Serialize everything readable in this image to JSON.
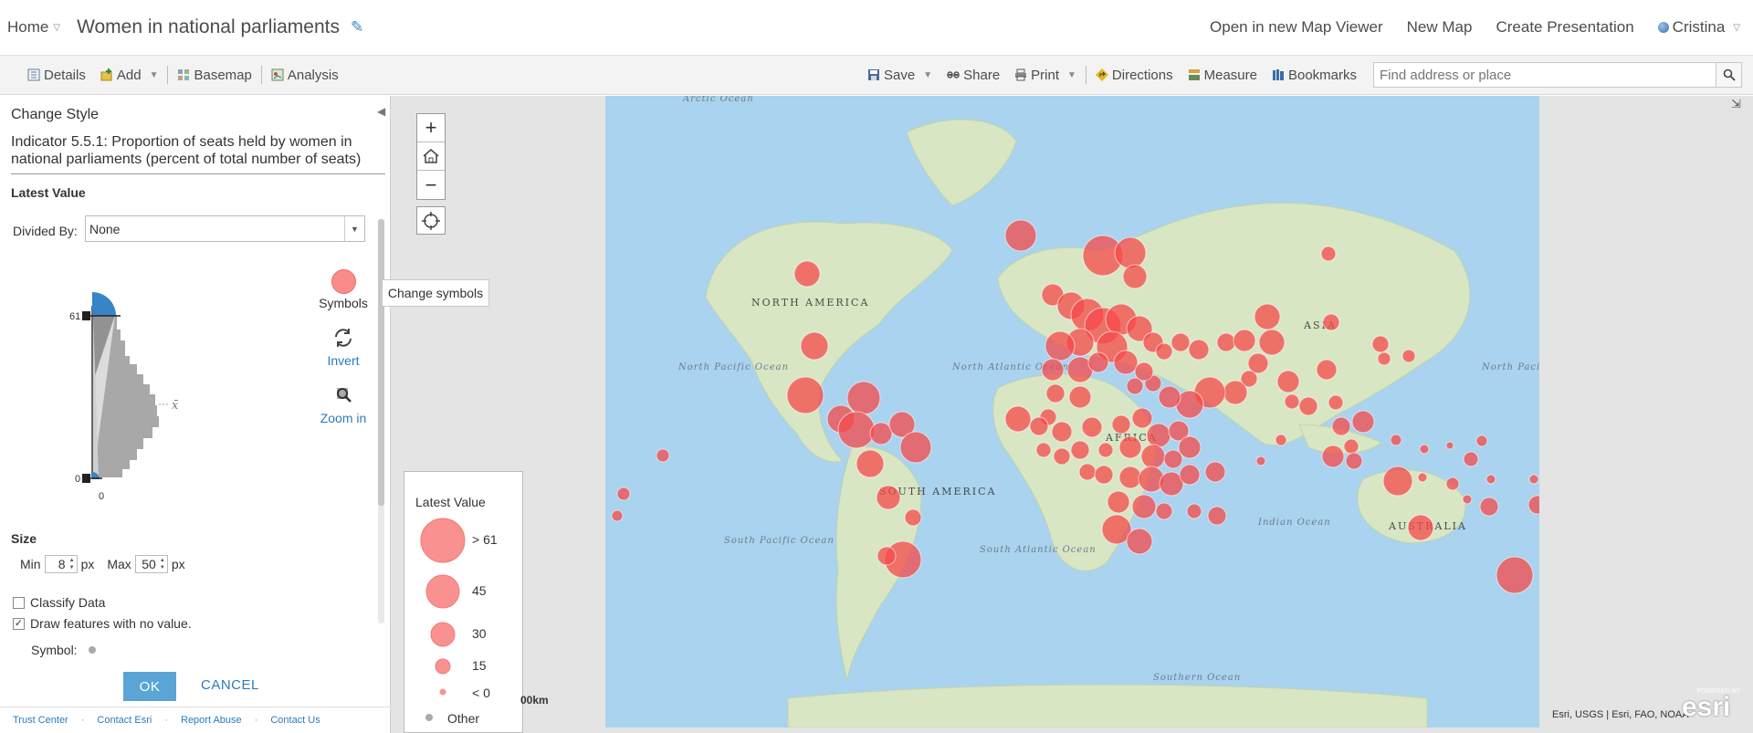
{
  "header": {
    "home_label": "Home",
    "title": "Women in national parliaments",
    "links": [
      "Open in new Map Viewer",
      "New Map",
      "Create Presentation"
    ],
    "user": "Cristina"
  },
  "toolbar": {
    "details": "Details",
    "add": "Add",
    "basemap": "Basemap",
    "analysis": "Analysis",
    "save": "Save",
    "share": "Share",
    "print": "Print",
    "directions": "Directions",
    "measure": "Measure",
    "bookmarks": "Bookmarks",
    "search_placeholder": "Find address or place"
  },
  "panel": {
    "title": "Change Style",
    "layer_title": "Indicator 5.5.1: Proportion of seats held by women in national parliaments (percent of total number of seats)",
    "attribute": "Latest Value",
    "divided_by_label": "Divided By:",
    "divided_by_value": "None",
    "histogram": {
      "max_label": "61",
      "min_label": "0",
      "axis_zero": "0",
      "mean_symbol": "x̄"
    },
    "tools": {
      "symbols": "Symbols",
      "invert": "Invert",
      "zoom_in": "Zoom in"
    },
    "size": {
      "heading": "Size",
      "min_label": "Min",
      "min_value": "8",
      "max_label": "Max",
      "max_value": "50",
      "unit": "px"
    },
    "classify_data": {
      "label": "Classify Data",
      "checked": false
    },
    "draw_no_value": {
      "label": "Draw features with no value.",
      "checked": true
    },
    "symbol_label": "Symbol:",
    "ok": "OK",
    "cancel": "CANCEL",
    "footer": [
      "Trust Center",
      "Contact Esri",
      "Report Abuse",
      "Contact Us"
    ]
  },
  "tooltip": "Change symbols",
  "legend": {
    "title": "Latest Value",
    "items": [
      {
        "label": "> 61"
      },
      {
        "label": "45"
      },
      {
        "label": "30"
      },
      {
        "label": "15"
      },
      {
        "label": "< 0"
      },
      {
        "label": "Other"
      }
    ]
  },
  "map": {
    "scale_text": "00km",
    "attribution": "Esri, USGS | Esri, FAO, NOAA",
    "logo_powered": "POWERED BY",
    "logo_name": "esri",
    "place_labels": [
      "Arctic Ocean",
      "NORTH AMERICA",
      "North Pacific Ocean",
      "North Atlantic Ocean",
      "SOUTH AMERICA",
      "South Pacific Ocean",
      "South Atlantic Ocean",
      "AFRICA",
      "Indian Ocean",
      "ASIA",
      "North Pacific Ocean",
      "AUSTRALIA",
      "Southern Ocean"
    ]
  },
  "colors": {
    "symbol_fill": "#f54a4a",
    "legend_fill": "#fa9191",
    "ok_button": "#5aa5d6",
    "link_blue": "#2b7bbd",
    "ocean": "#a9d3ee",
    "land": "#d8e6c4"
  }
}
